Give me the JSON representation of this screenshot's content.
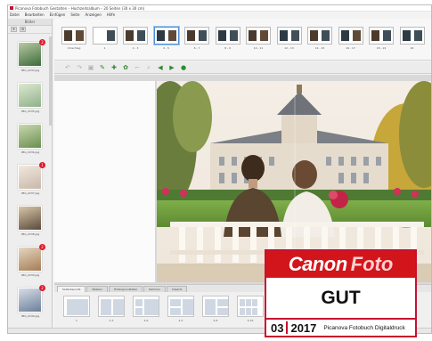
{
  "window": {
    "title": "Picanova Fotobuch Gestalten – Hochzeitsalbum – 20 Seiten (30 x 30 cm)"
  },
  "menu": [
    "Datei",
    "Bearbeiten",
    "Einfügen",
    "Seite",
    "Anzeigen",
    "Hilfe"
  ],
  "sidebar": {
    "header": "Bilder",
    "tools": [
      "+",
      "⊖"
    ],
    "items": [
      {
        "label": "IMG_0234.jpg",
        "badge": "2",
        "colors": [
          "#3d6b3a",
          "#b8c9a4"
        ]
      },
      {
        "label": "IMG_0235.jpg",
        "badge": "",
        "colors": [
          "#8fb18a",
          "#dde8cf"
        ]
      },
      {
        "label": "IMG_0236.jpg",
        "badge": "",
        "colors": [
          "#6a8f4f",
          "#c9d7b0"
        ]
      },
      {
        "label": "IMG_0237.jpg",
        "badge": "1",
        "colors": [
          "#c9b7a9",
          "#f1e8df"
        ]
      },
      {
        "label": "IMG_0238.jpg",
        "badge": "",
        "colors": [
          "#5a4a3c",
          "#d9c6a8"
        ]
      },
      {
        "label": "IMG_0239.jpg",
        "badge": "2",
        "colors": [
          "#a57d57",
          "#e5d6c0"
        ]
      },
      {
        "label": "IMG_0240.jpg",
        "badge": "2",
        "colors": [
          "#6b7f9a",
          "#d8dde6"
        ]
      }
    ]
  },
  "pages": [
    {
      "label": "Umschlag",
      "selected": false
    },
    {
      "label": "1",
      "selected": false
    },
    {
      "label": "2 - 3",
      "selected": false
    },
    {
      "label": "4 - 5",
      "selected": true
    },
    {
      "label": "6 - 7",
      "selected": false
    },
    {
      "label": "8 - 9",
      "selected": false
    },
    {
      "label": "10 - 11",
      "selected": false
    },
    {
      "label": "12 - 13",
      "selected": false
    },
    {
      "label": "14 - 15",
      "selected": false
    },
    {
      "label": "16 - 17",
      "selected": false
    },
    {
      "label": "18 - 19",
      "selected": false
    },
    {
      "label": "20",
      "selected": false
    }
  ],
  "toolbar": {
    "buttons": [
      {
        "name": "undo-icon",
        "glyph": "↶",
        "style": "grey"
      },
      {
        "name": "redo-icon",
        "glyph": "↷",
        "style": "grey"
      },
      {
        "name": "save-icon",
        "glyph": "▣",
        "style": "grey"
      },
      {
        "name": "add-text-icon",
        "glyph": "✎",
        "style": "green"
      },
      {
        "name": "add-image-icon",
        "glyph": "✚",
        "style": "green"
      },
      {
        "name": "effects-icon",
        "glyph": "✿",
        "style": "green"
      },
      {
        "name": "crop-icon",
        "glyph": "⌐",
        "style": "grey"
      },
      {
        "name": "zoom-icon",
        "glyph": "⌕",
        "style": "grey"
      },
      {
        "name": "arrow-left-icon",
        "glyph": "◀",
        "style": "green"
      },
      {
        "name": "arrow-right-icon",
        "glyph": "▶",
        "style": "green"
      },
      {
        "name": "help-icon",
        "glyph": "●",
        "style": "green"
      }
    ]
  },
  "bottom_tabs": [
    {
      "label": "Seitenlayouts",
      "active": true
    },
    {
      "label": "Masken",
      "active": false
    },
    {
      "label": "Hintergrundbilder",
      "active": false
    },
    {
      "label": "Rahmen",
      "active": false
    },
    {
      "label": "Cliparts",
      "active": false
    }
  ],
  "layouts": [
    {
      "label": "1"
    },
    {
      "label": "2-3"
    },
    {
      "label": "4-6"
    },
    {
      "label": "4-5"
    },
    {
      "label": "6-8"
    },
    {
      "label": "9-16"
    },
    {
      "label": ""
    },
    {
      "label": ""
    }
  ],
  "seal": {
    "brand_a": "Canon",
    "brand_b": "Foto",
    "rating": "GUT",
    "issue": "03",
    "year": "2017",
    "product": "Picanova Fotobuch Digitaldruck",
    "brand_color": "#d2151b"
  }
}
